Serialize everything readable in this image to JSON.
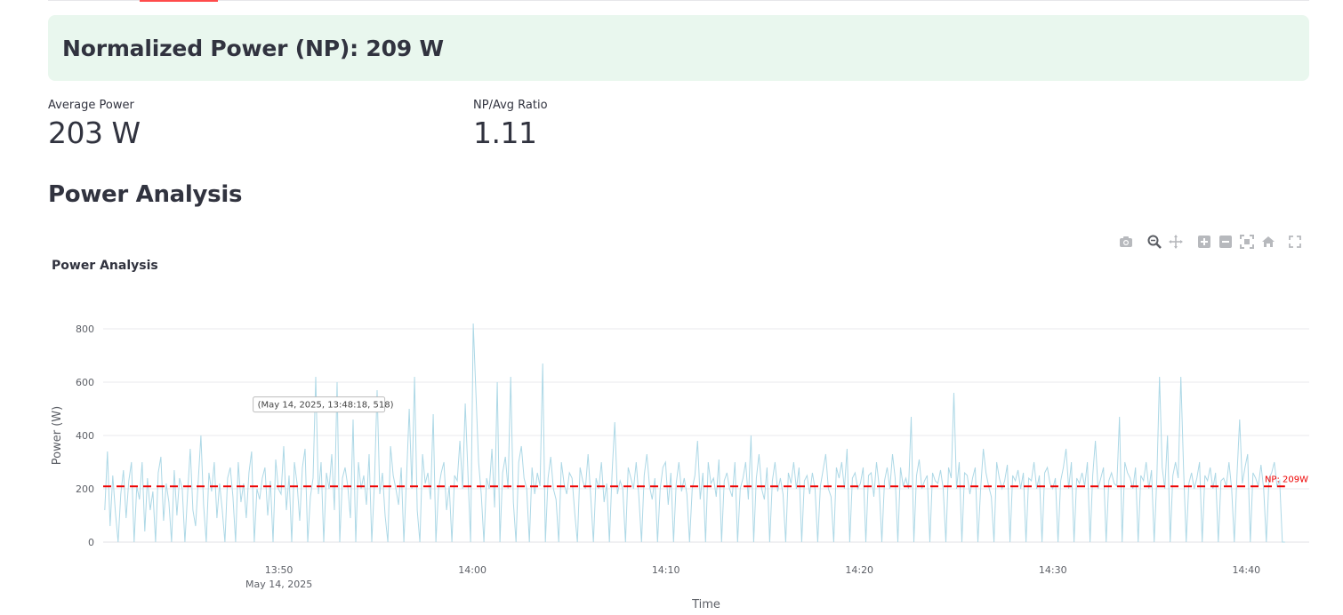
{
  "banner": {
    "text": "Normalized Power (NP): 209 W"
  },
  "metrics": [
    {
      "label": "Average Power",
      "value": "203 W"
    },
    {
      "label": "NP/Avg Ratio",
      "value": "1.11"
    }
  ],
  "section": {
    "title": "Power Analysis"
  },
  "modebar": {
    "icons": [
      "camera-icon",
      "zoom-icon",
      "pan-icon",
      "zoom-in-icon",
      "zoom-out-icon",
      "autoscale-icon",
      "reset-axes-icon",
      "fullscreen-icon"
    ],
    "active": "zoom-icon"
  },
  "colors": {
    "line": "#add8e6",
    "np_line": "#ee0000",
    "banner_bg": "#e9f7ee",
    "tab_accent": "#ff4b4b",
    "grid": "#e9e9ee"
  },
  "chart_data": {
    "type": "line",
    "title": "Power Analysis",
    "xlabel": "Time",
    "ylabel": "Power (W)",
    "date_label": "May 14, 2025",
    "x_start": "13:41:00",
    "x_end": "14:42:00",
    "xlim": [
      "13:40:55",
      "14:43:15"
    ],
    "ylim": [
      0,
      800
    ],
    "yticks": [
      0,
      200,
      400,
      600,
      800
    ],
    "xticks": [
      "13:50",
      "14:00",
      "14:10",
      "14:20",
      "14:30",
      "14:40"
    ],
    "grid": true,
    "np_line": {
      "value": 209,
      "label": "NP: 209W",
      "style": "dashed"
    },
    "hover": {
      "x": "13:48:18",
      "y": 518,
      "text": "(May 14, 2025, 13:48:18, 518)"
    },
    "series": [
      {
        "name": "Power",
        "values": [
          120,
          340,
          60,
          250,
          110,
          0,
          180,
          270,
          90,
          230,
          300,
          0,
          210,
          160,
          300,
          40,
          240,
          120,
          190,
          0,
          260,
          320,
          80,
          220,
          150,
          0,
          270,
          100,
          240,
          200,
          0,
          180,
          350,
          120,
          60,
          230,
          400,
          140,
          0,
          260,
          190,
          300,
          90,
          220,
          120,
          0,
          240,
          280,
          170,
          0,
          300,
          150,
          220,
          90,
          260,
          340,
          0,
          200,
          160,
          240,
          280,
          100,
          230,
          0,
          310,
          200,
          180,
          360,
          120,
          250,
          0,
          300,
          220,
          80,
          280,
          350,
          0,
          170,
          240,
          620,
          180,
          300,
          0,
          260,
          200,
          330,
          120,
          600,
          0,
          240,
          280,
          210,
          90,
          460,
          0,
          300,
          200,
          250,
          140,
          330,
          0,
          220,
          570,
          180,
          260,
          100,
          0,
          360,
          250,
          200,
          140,
          280,
          0,
          240,
          500,
          200,
          620,
          120,
          0,
          330,
          220,
          260,
          160,
          480,
          0,
          200,
          260,
          300,
          120,
          210,
          0,
          250,
          230,
          380,
          200,
          520,
          260,
          0,
          820,
          560,
          300,
          180,
          0,
          240,
          200,
          350,
          130,
          600,
          0,
          260,
          320,
          200,
          620,
          150,
          0,
          300,
          360,
          240,
          200,
          0,
          280,
          180,
          260,
          210,
          670,
          0,
          240,
          320,
          200,
          160,
          0,
          300,
          220,
          180,
          260,
          240,
          110,
          0,
          280,
          230,
          200,
          330,
          170,
          0,
          240,
          200,
          300,
          150,
          220,
          0,
          260,
          450,
          180,
          230,
          200,
          0,
          280,
          240,
          200,
          300,
          170,
          0,
          250,
          330,
          210,
          160,
          240,
          0,
          200,
          280,
          300,
          140,
          260,
          0,
          220,
          300,
          190,
          240,
          180,
          0,
          200,
          250,
          380,
          160,
          260,
          0,
          300,
          220,
          240,
          170,
          310,
          0,
          230,
          260,
          200,
          170,
          300,
          0,
          200,
          240,
          300,
          160,
          400,
          0,
          240,
          330,
          200,
          160,
          280,
          0,
          230,
          300,
          190,
          240,
          180,
          0,
          260,
          220,
          300,
          200,
          280,
          0,
          230,
          250,
          180,
          260,
          200,
          0,
          210,
          270,
          330,
          200,
          170,
          0,
          280,
          240,
          300,
          200,
          350,
          0,
          240,
          260,
          200,
          220,
          280,
          0,
          250,
          260,
          170,
          300,
          210,
          0,
          230,
          280,
          200,
          330,
          240,
          0,
          280,
          210,
          240,
          200,
          470,
          0,
          250,
          310,
          200,
          230,
          250,
          0,
          260,
          230,
          220,
          270,
          200,
          0,
          280,
          240,
          560,
          200,
          300,
          0,
          260,
          250,
          180,
          240,
          280,
          0,
          200,
          350,
          260,
          210,
          170,
          0,
          300,
          240,
          200,
          230,
          290,
          0,
          250,
          230,
          270,
          200,
          260,
          0,
          240,
          230,
          300,
          200,
          250,
          0,
          260,
          280,
          220,
          200,
          240,
          0,
          230,
          280,
          350,
          200,
          300,
          0,
          240,
          220,
          260,
          210,
          300,
          0,
          250,
          380,
          200,
          240,
          280,
          0,
          230,
          260,
          220,
          210,
          470,
          0,
          300,
          260,
          240,
          200,
          280,
          0,
          250,
          230,
          300,
          200,
          270,
          0,
          240,
          620,
          280,
          200,
          400,
          0,
          250,
          300,
          240,
          620,
          280,
          0,
          220,
          260,
          200,
          240,
          300,
          0,
          250,
          230,
          280,
          200,
          260,
          0,
          230,
          240,
          210,
          300,
          200,
          0,
          250,
          460,
          220,
          280,
          330,
          0,
          260,
          240,
          210,
          290,
          200,
          0,
          240,
          260,
          300,
          210,
          230,
          0,
          0
        ]
      }
    ]
  }
}
